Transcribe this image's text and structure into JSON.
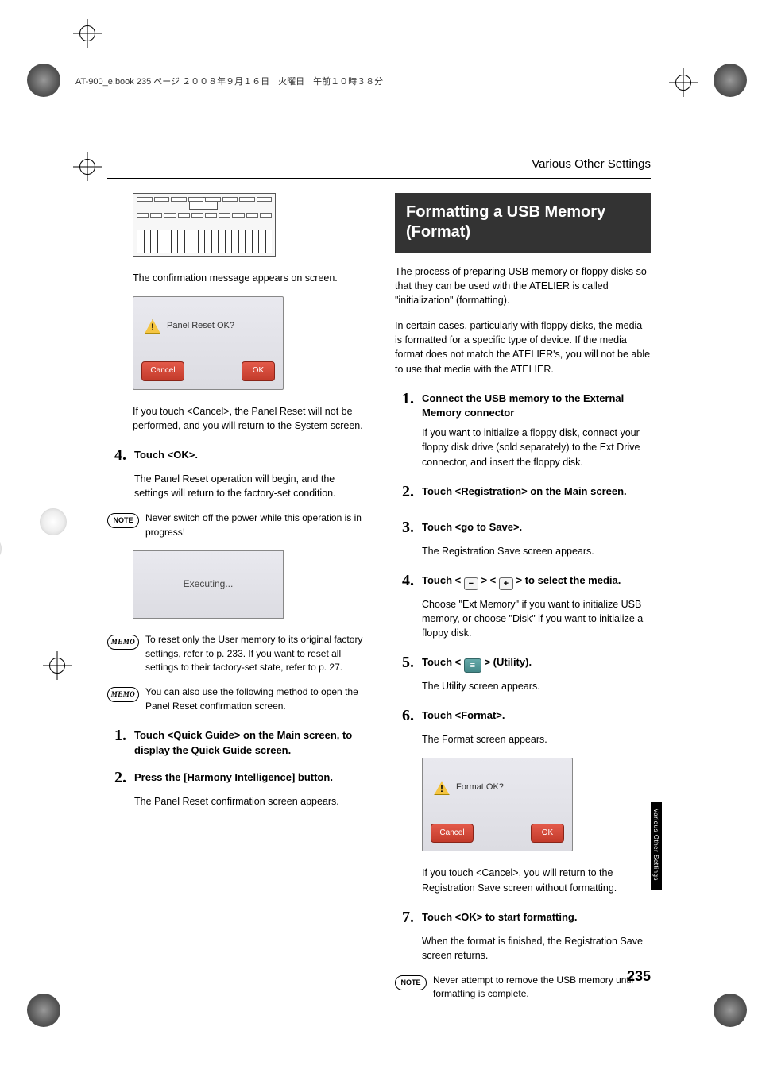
{
  "header": {
    "bookinfo": "AT-900_e.book  235 ページ  ２００８年９月１６日　火曜日　午前１０時３８分"
  },
  "section_title": "Various Other Settings",
  "left": {
    "confirm_msg": "The confirmation message appears on screen.",
    "dialog1": {
      "message": "Panel Reset OK?",
      "cancel": "Cancel",
      "ok": "OK"
    },
    "cancel_note": "If you touch <Cancel>, the Panel Reset will not be performed, and you will return to the System screen.",
    "step4": {
      "num": "4.",
      "title": "Touch <OK>.",
      "body": "The Panel Reset operation will begin, and the settings will return to the factory-set condition."
    },
    "note1": "Never switch off the power while this operation is in progress!",
    "executing": "Executing...",
    "memo1": "To reset only the User memory to its original factory settings, refer to p. 233. If you want to reset all settings to their factory-set state, refer to p. 27.",
    "memo2": "You can also use the following method to open the Panel Reset confirmation screen.",
    "step1b": {
      "num": "1.",
      "title": "Touch <Quick Guide> on the Main screen, to display the Quick Guide screen."
    },
    "step2b": {
      "num": "2.",
      "title": "Press the [Harmony Intelligence] button.",
      "body": "The Panel Reset confirmation screen appears."
    }
  },
  "right": {
    "banner": "Formatting a USB Memory (Format)",
    "intro1": "The process of preparing USB memory or floppy disks so that they can be used with the ATELIER is called \"initialization\" (formatting).",
    "intro2": "In certain cases, particularly with floppy disks, the media is formatted for a specific type of device. If the media format does not match the ATELIER's, you will not be able to use that media with the ATELIER.",
    "step1": {
      "num": "1.",
      "title": "Connect the USB memory to the External Memory connector",
      "body": "If you want to initialize a floppy disk, connect your floppy disk drive (sold separately) to the Ext Drive connector, and insert the floppy disk."
    },
    "step2": {
      "num": "2.",
      "title": "Touch <Registration> on the Main screen."
    },
    "step3": {
      "num": "3.",
      "title": "Touch <go to Save>.",
      "body": "The Registration Save screen appears."
    },
    "step4": {
      "num": "4.",
      "title_pre": "Touch < ",
      "title_mid": " > < ",
      "title_post": " > to select the media.",
      "body": "Choose \"Ext Memory\" if you want to initialize USB memory, or choose \"Disk\" if you want to initialize a floppy disk."
    },
    "step5": {
      "num": "5.",
      "title_pre": "Touch < ",
      "title_post": " > (Utility).",
      "body": "The Utility screen appears."
    },
    "step6": {
      "num": "6.",
      "title": "Touch <Format>.",
      "body": "The Format screen appears."
    },
    "dialog2": {
      "message": "Format OK?",
      "cancel": "Cancel",
      "ok": "OK"
    },
    "cancel_note": "If you touch <Cancel>, you will return to the Registration Save screen without formatting.",
    "step7": {
      "num": "7.",
      "title": "Touch <OK> to start formatting.",
      "body": "When the format is finished, the Registration Save screen returns."
    },
    "note2": "Never attempt to remove the USB memory until formatting is complete."
  },
  "labels": {
    "note": "NOTE",
    "memo": "MEMO"
  },
  "side_tab": "Various Other Settings",
  "page_number": "235"
}
